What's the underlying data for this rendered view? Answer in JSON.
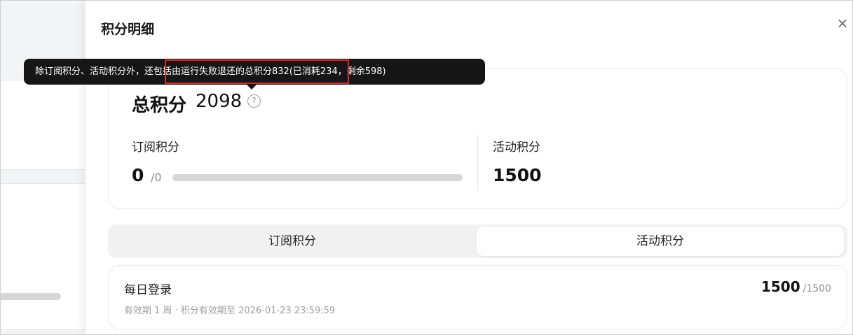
{
  "drawer": {
    "title": "积分明细",
    "close_label": "×"
  },
  "tooltip": {
    "text_part1": "除订阅积分、活动积分外，",
    "text_highlight": "还包括由运行失败退还的总积分832",
    "text_part2": "(已消耗234，剩余598)"
  },
  "summary": {
    "total_label": "总积分",
    "total_value": "2098",
    "help_icon_glyph": "?",
    "subscription": {
      "label": "订阅积分",
      "value": "0",
      "max": "/0",
      "progress": 0
    },
    "activity": {
      "label": "活动积分",
      "value": "1500"
    }
  },
  "tabs": [
    {
      "label": "订阅积分",
      "active": false
    },
    {
      "label": "活动积分",
      "active": true
    }
  ],
  "records": [
    {
      "title": "每日登录",
      "subtitle": "有效期 1 周 · 积分有效期至 2026-01-23 23:59:59",
      "value": "1500",
      "max": "/1500"
    }
  ],
  "colors": {
    "tooltip_bg": "#161616",
    "highlight_border": "#e02424",
    "progress_track": "#d7d7d7"
  },
  "icons": [
    "close-icon",
    "help-circle-icon"
  ]
}
